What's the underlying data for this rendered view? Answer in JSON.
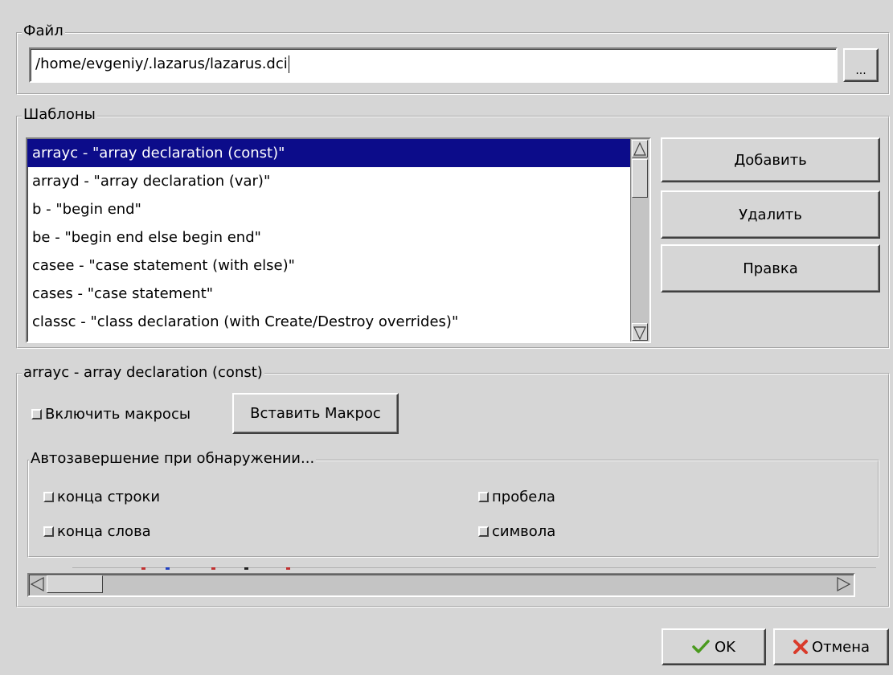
{
  "file_group": {
    "legend": "Файл",
    "path_value": "/home/evgeniy/.lazarus/lazarus.dci",
    "browse_label": "..."
  },
  "templates_group": {
    "legend": "Шаблоны",
    "items": [
      "arrayc - \"array declaration (const)\"",
      "arrayd - \"array declaration (var)\"",
      "b - \"begin end\"",
      "be - \"begin end else begin end\"",
      "casee - \"case statement (with else)\"",
      "cases - \"case statement\"",
      "classc - \"class declaration (with Create/Destroy overrides)\""
    ],
    "selected_index": 0,
    "add_label": "Добавить",
    "delete_label": "Удалить",
    "edit_label": "Правка"
  },
  "editor_group": {
    "legend": "arrayc - array declaration (const)",
    "enable_macros_label": "Включить макросы",
    "insert_macro_label": "Вставить Макрос",
    "autocomplete": {
      "legend": "Автозавершение при обнаружении...",
      "line_end_label": "конца строки",
      "space_label": "пробела",
      "word_end_label": "конца слова",
      "symbol_label": "символа"
    }
  },
  "footer": {
    "ok_label": "OK",
    "cancel_label": "Отмена"
  },
  "colors": {
    "selection": "#0c0c8a",
    "ok_check": "#4a9a1e",
    "cancel_x": "#d93a2a"
  },
  "icons": {
    "ok": "check-icon",
    "cancel": "x-icon",
    "scroll_up": "triangle-up-icon",
    "scroll_down": "triangle-down-icon",
    "scroll_left": "triangle-left-icon",
    "scroll_right": "triangle-right-icon"
  }
}
